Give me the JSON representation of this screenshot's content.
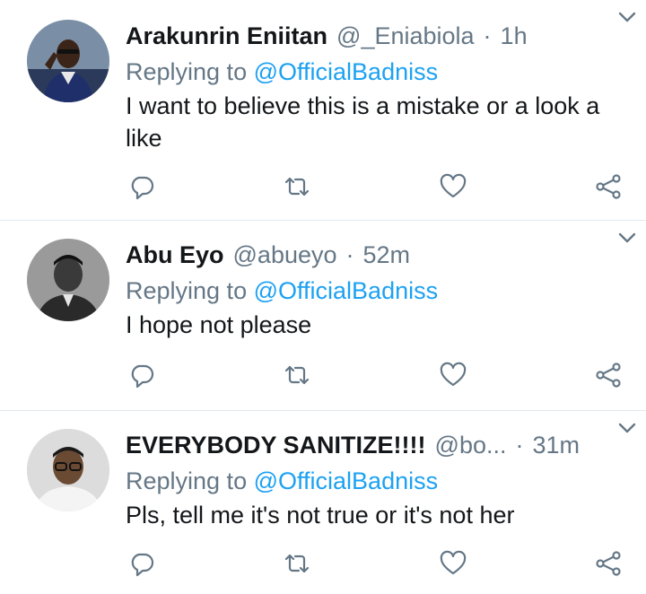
{
  "tweets": [
    {
      "name": "Arakunrin Eniitan",
      "handle": "@_Eniabiola",
      "separator": "·",
      "time": "1h",
      "replying_prefix": "Replying to",
      "replying_to": "@OfficialBadniss",
      "text": "I want to believe this is a mistake or a look a like"
    },
    {
      "name": "Abu Eyo",
      "handle": "@abueyo",
      "separator": "·",
      "time": "52m",
      "replying_prefix": "Replying to",
      "replying_to": "@OfficialBadniss",
      "text": "I hope not please"
    },
    {
      "name": "EVERYBODY SANITIZE!!!!",
      "handle": "@bo...",
      "separator": "·",
      "time": "31m",
      "replying_prefix": "Replying to",
      "replying_to": "@OfficialBadniss",
      "text": "Pls, tell me it's not true or it's not her"
    }
  ],
  "icons": {
    "reply": "reply-icon",
    "retweet": "retweet-icon",
    "like": "heart-icon",
    "share": "share-icon",
    "menu": "chevron-down-icon"
  },
  "colors": {
    "mention": "#1da1f2",
    "secondary_text": "#657786",
    "primary_text": "#14171a",
    "divider": "#e1e8ed"
  }
}
